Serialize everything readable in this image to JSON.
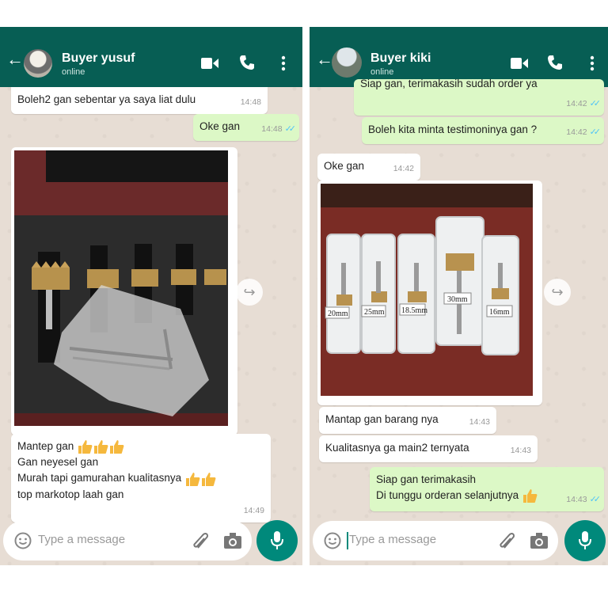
{
  "left_chat": {
    "contact_name": "Buyer yusuf",
    "contact_status": "online",
    "messages": [
      {
        "text": "Boleh2 gan sebentar ya saya liat dulu",
        "time": "14:48",
        "dir": "in"
      },
      {
        "text": "Oke gan",
        "time": "14:48",
        "dir": "out"
      },
      {
        "line1": "Mantep gan",
        "line2": "Gan neyesel gan",
        "line3": "Murah tapi gamurahan kualitasnya",
        "line4": "top markotop laah gan",
        "time": "14:49",
        "dir": "in"
      }
    ],
    "input_placeholder": "Type a message"
  },
  "right_chat": {
    "contact_name": "Buyer kiki",
    "contact_status": "online",
    "messages": [
      {
        "text": "Siap gan, terimakasih sudah order ya",
        "time": "14:42",
        "dir": "out"
      },
      {
        "text": "Boleh kita minta testimoninya gan ?",
        "time": "14:42",
        "dir": "out"
      },
      {
        "text": "Oke gan",
        "time": "14:42",
        "dir": "in"
      },
      {
        "text": "Mantap gan barang nya",
        "time": "14:43",
        "dir": "in"
      },
      {
        "text": "Kualitasnya ga main2 ternyata",
        "time": "14:43",
        "dir": "in"
      },
      {
        "line1": "Siap gan terimakasih",
        "line2": "Di tunggu orderan selanjutnya",
        "time": "14:43",
        "dir": "out"
      }
    ],
    "input_placeholder": "Type a message",
    "photo_labels": [
      "20mm",
      "25mm",
      "18.5mm",
      "30mm",
      "16mm"
    ]
  },
  "ticks": "✓✓",
  "colors": {
    "header": "#075e54",
    "outgoing": "#dcf8c6",
    "incoming": "#ffffff",
    "mic": "#00897b",
    "ticks": "#4fc3f7"
  }
}
